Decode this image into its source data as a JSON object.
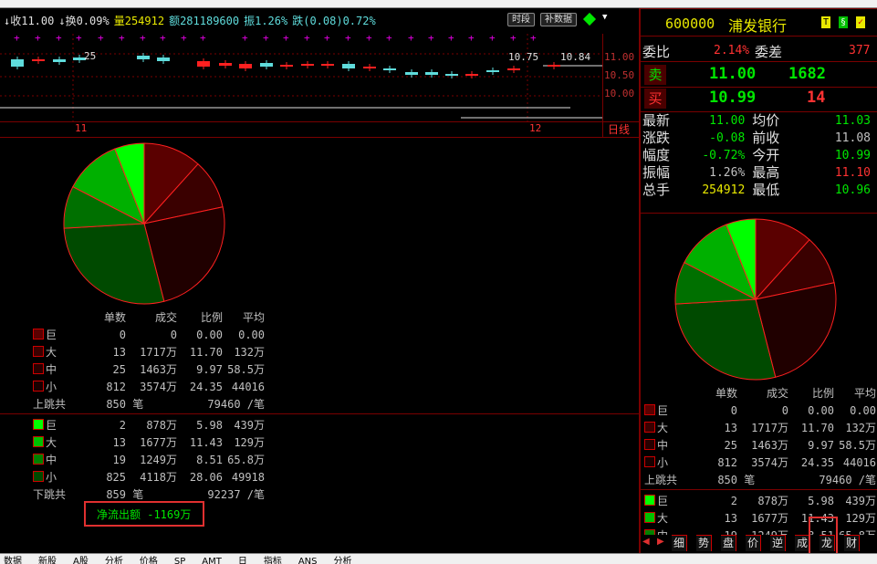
{
  "kline": {
    "info": [
      {
        "text": "↓收11.00",
        "color": "#e0e0e0"
      },
      {
        "text": "↓换0.09%",
        "color": "#e0e0e0"
      },
      {
        "text": "量254912",
        "color": "#e8e800"
      },
      {
        "text": "额281189600",
        "color": "#5fdcdc"
      },
      {
        "text": "振1.26%",
        "color": "#5fdcdc"
      },
      {
        "text": "跌(0.08)0.72%",
        "color": "#5fdcdc"
      }
    ],
    "btn_time": "时段",
    "btn_fill": "补数据",
    "price_labels": [
      "11.00",
      "10.50",
      "10.00"
    ],
    "low_label": "10.75",
    "high_label": "10.84",
    "left_label": "25",
    "date_left": "11",
    "date_right": "12",
    "period": "日线"
  },
  "quote": {
    "code": "600000",
    "name": "浦发银行",
    "badges": [
      "T",
      "§",
      "✓"
    ],
    "weibi_label": "委比",
    "weibi_value": "2.14%",
    "weicha_label": "委差",
    "weicha_value": "377",
    "sell_label": "卖",
    "sell_price": "11.00",
    "sell_vol": "1682",
    "buy_label": "买",
    "buy_price": "10.99",
    "buy_vol": "14",
    "rows": [
      {
        "l1": "最新",
        "v1": "11.00",
        "c1": "#00e600",
        "l2": "均价",
        "v2": "11.03",
        "c2": "#00e600"
      },
      {
        "l1": "涨跌",
        "v1": "-0.08",
        "c1": "#00e600",
        "l2": "前收",
        "v2": "11.08",
        "c2": "#c0c0c0"
      },
      {
        "l1": "幅度",
        "v1": "-0.72%",
        "c1": "#00e600",
        "l2": "今开",
        "v2": "10.99",
        "c2": "#00e600"
      },
      {
        "l1": "振幅",
        "v1": "1.26%",
        "c1": "#c0c0c0",
        "l2": "最高",
        "v2": "11.10",
        "c2": "#ff3232"
      },
      {
        "l1": "总手",
        "v1": "254912",
        "c1": "#e8e800",
        "l2": "最低",
        "v2": "10.96",
        "c2": "#00e600"
      }
    ]
  },
  "flow": {
    "headers": [
      "单数",
      "成交",
      "比例",
      "平均"
    ],
    "inflow": [
      {
        "label": "巨",
        "color": "#5a0000",
        "n": "0",
        "amt": "0",
        "pct": "0.00",
        "avg": "0.00"
      },
      {
        "label": "大",
        "color": "#3a0000",
        "n": "13",
        "amt": "1717万",
        "pct": "11.70",
        "avg": "132万"
      },
      {
        "label": "中",
        "color": "#280000",
        "n": "25",
        "amt": "1463万",
        "pct": "9.97",
        "avg": "58.5万"
      },
      {
        "label": "小",
        "color": "#180000",
        "n": "812",
        "amt": "3574万",
        "pct": "24.35",
        "avg": "44016"
      }
    ],
    "up_total_label": "上跳共",
    "up_total_count": "850",
    "up_total_unit": "笔",
    "up_total_avg": "79460 /笔",
    "outflow": [
      {
        "label": "巨",
        "color": "#00ff00",
        "n": "2",
        "amt": "878万",
        "pct": "5.98",
        "avg": "439万"
      },
      {
        "label": "大",
        "color": "#00c000",
        "n": "13",
        "amt": "1677万",
        "pct": "11.43",
        "avg": "129万"
      },
      {
        "label": "中",
        "color": "#008000",
        "n": "19",
        "amt": "1249万",
        "pct": "8.51",
        "avg": "65.8万"
      },
      {
        "label": "小",
        "color": "#004a00",
        "n": "825",
        "amt": "4118万",
        "pct": "28.06",
        "avg": "49918"
      }
    ],
    "down_total_label": "下跳共",
    "down_total_count": "859",
    "down_total_unit": "笔",
    "down_total_avg": "92237 /笔",
    "net_label": "净流出额 -1169万"
  },
  "pie": {
    "segments": [
      {
        "value": 11.7,
        "color": "#5a0000"
      },
      {
        "value": 9.97,
        "color": "#3a0000"
      },
      {
        "value": 24.35,
        "color": "#200000"
      },
      {
        "value": 28.06,
        "color": "#004a00"
      },
      {
        "value": 8.51,
        "color": "#007000"
      },
      {
        "value": 11.43,
        "color": "#00b000"
      },
      {
        "value": 5.98,
        "color": "#00ff00"
      }
    ]
  },
  "tabs": [
    "细",
    "势",
    "盘",
    "价",
    "逆",
    "成",
    "龙",
    "财"
  ],
  "taskbar": [
    "数据",
    "新股",
    "A股",
    "分析",
    "价格",
    "SP",
    "AMT",
    "日",
    "指标",
    "ANS",
    "分析"
  ]
}
